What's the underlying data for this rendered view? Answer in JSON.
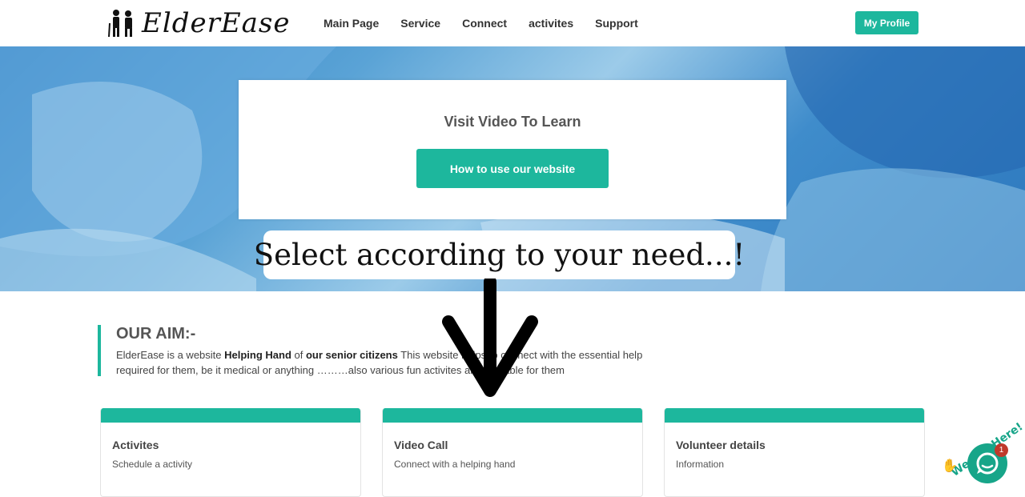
{
  "header": {
    "logo_text": "ElderEase",
    "nav": [
      "Main Page",
      "Service",
      "Connect",
      "activites",
      "Support"
    ],
    "profile_label": "My Profile"
  },
  "hero": {
    "title": "Visit Video To Learn",
    "button_label": "How to use our website",
    "callout": "Select according to your need...!"
  },
  "aim": {
    "title": "OUR AIM:-",
    "line1_a": "ElderEase is a website ",
    "line1_b": "Helping Hand",
    "line1_c": " of ",
    "line1_d": "our senior citizens",
    "line1_e": " This website helps to connect with the essential help",
    "line2": "required for them, be it medical or anything ………also various fun activites are available for them"
  },
  "cards": [
    {
      "title": "Activites",
      "subtitle": "Schedule a activity"
    },
    {
      "title": "Video Call",
      "subtitle": "Connect with a helping hand"
    },
    {
      "title": "Volunteer details",
      "subtitle": "Information"
    }
  ],
  "chat": {
    "label": "We Are Here!",
    "badge": "1",
    "wave_icon": "waving-hand-icon",
    "bubble_icon": "chat-bubble-icon"
  },
  "colors": {
    "accent": "#1db79d",
    "badge": "#c0392b"
  }
}
